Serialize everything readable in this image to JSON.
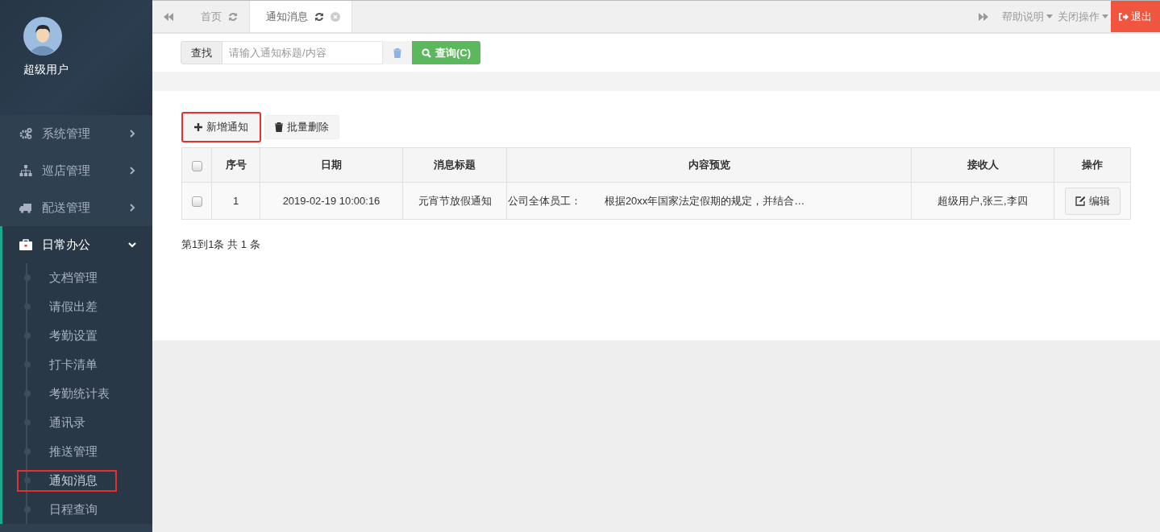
{
  "user": {
    "name": "超级用户"
  },
  "menu": [
    {
      "label": "系统管理",
      "kind": "gears",
      "expanded": false
    },
    {
      "label": "巡店管理",
      "kind": "sitemap",
      "expanded": false
    },
    {
      "label": "配送管理",
      "kind": "truck",
      "expanded": false
    },
    {
      "label": "日常办公",
      "kind": "briefcase",
      "expanded": true,
      "children": [
        {
          "label": "文档管理",
          "highlighted": false
        },
        {
          "label": "请假出差",
          "highlighted": false
        },
        {
          "label": "考勤设置",
          "highlighted": false
        },
        {
          "label": "打卡清单",
          "highlighted": false
        },
        {
          "label": "考勤统计表",
          "highlighted": false
        },
        {
          "label": "通讯录",
          "highlighted": false
        },
        {
          "label": "推送管理",
          "highlighted": false
        },
        {
          "label": "通知消息",
          "highlighted": true
        },
        {
          "label": "日程查询",
          "highlighted": false
        }
      ]
    }
  ],
  "tabs": [
    {
      "label": "首页",
      "selected": false,
      "closable": false
    },
    {
      "label": "通知消息",
      "selected": true,
      "closable": true
    }
  ],
  "header_actions": [
    {
      "label": "帮助说明"
    },
    {
      "label": "关闭操作"
    }
  ],
  "logout": "退出",
  "search": {
    "label": "查找",
    "placeholder": "请输入通知标题/内容",
    "button": "查询(C)"
  },
  "toolbar": [
    {
      "label": "新增通知",
      "kind": "add",
      "highlighted": true
    },
    {
      "label": "批量删除",
      "kind": "delete",
      "highlighted": false
    }
  ],
  "table": {
    "all_checked": false,
    "columns": [
      "序号",
      "日期",
      "消息标题",
      "内容预览",
      "接收人",
      "操作"
    ],
    "rows": [
      {
        "checked": false,
        "cells": [
          "1",
          "2019-02-19 10:00:16",
          "元宵节放假通知",
          "公司全体员工：        根据20xx年国家法定假期的规定，并结合…",
          "超级用户,张三,李四"
        ],
        "action": "编辑"
      }
    ]
  },
  "pagination": "第1到1条 共 1 条"
}
